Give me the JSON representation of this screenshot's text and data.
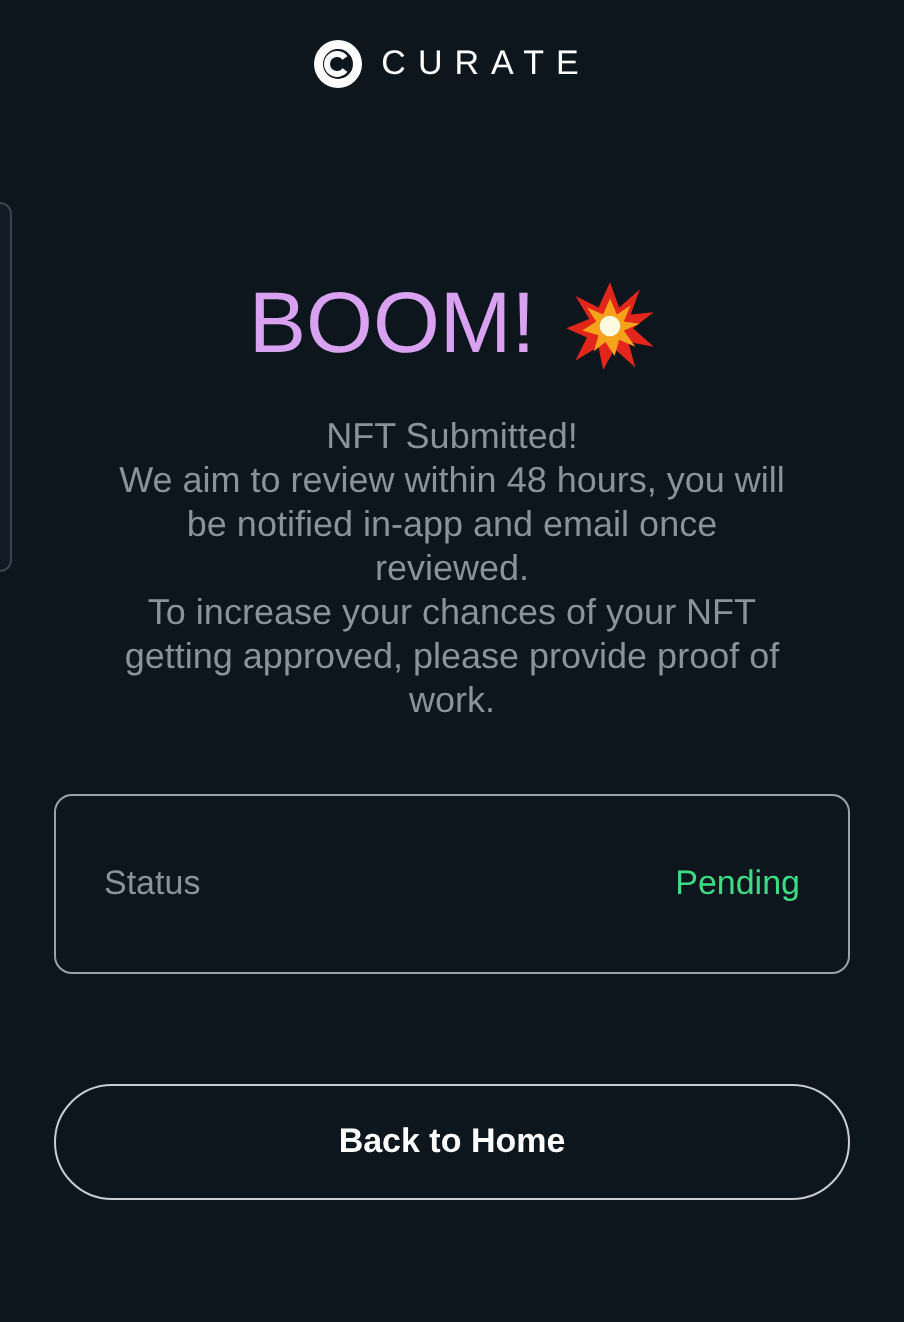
{
  "header": {
    "brand": "CURATE"
  },
  "headline": "BOOM!",
  "message": [
    "NFT Submitted!",
    "We aim to review within 48 hours, you will be notified in-app and email once reviewed.",
    "To increase your chances of your NFT getting approved, please provide proof of work."
  ],
  "status": {
    "label": "Status",
    "value": "Pending",
    "color": "#3ddc84"
  },
  "buttons": [
    {
      "label": "Back to Home"
    }
  ]
}
